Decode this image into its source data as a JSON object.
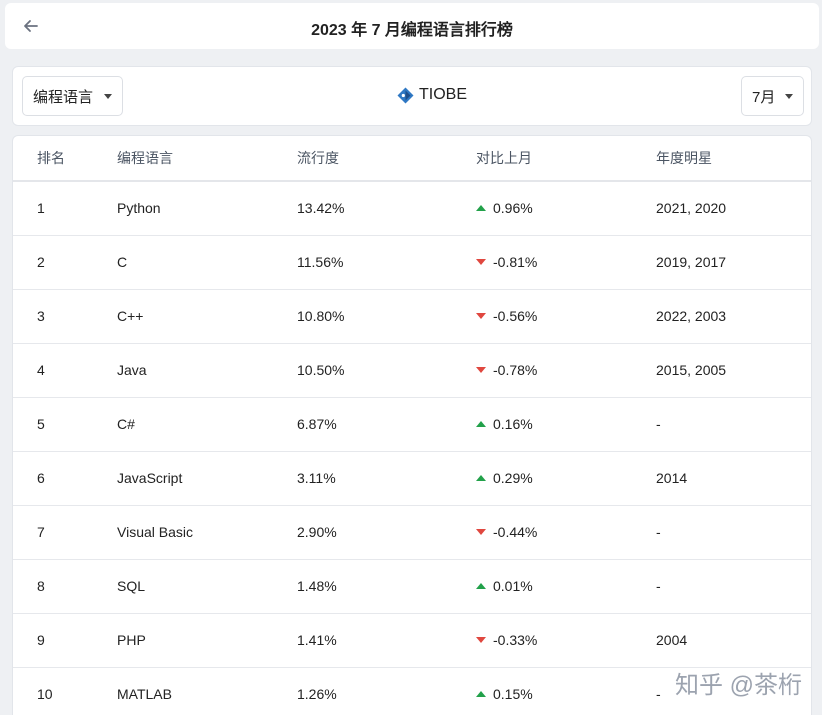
{
  "header": {
    "title": "2023 年 7 月编程语言排行榜"
  },
  "toolbar": {
    "language_select": "编程语言",
    "brand": "TIOBE",
    "month_select": "7月"
  },
  "table": {
    "columns": [
      "排名",
      "编程语言",
      "流行度",
      "对比上月",
      "年度明星"
    ],
    "rows": [
      {
        "rank": "1",
        "language": "Python",
        "popularity": "13.42%",
        "change": "0.96%",
        "direction": "up",
        "hof": "2021, 2020"
      },
      {
        "rank": "2",
        "language": "C",
        "popularity": "11.56%",
        "change": "-0.81%",
        "direction": "down",
        "hof": "2019, 2017"
      },
      {
        "rank": "3",
        "language": "C++",
        "popularity": "10.80%",
        "change": "-0.56%",
        "direction": "down",
        "hof": "2022, 2003"
      },
      {
        "rank": "4",
        "language": "Java",
        "popularity": "10.50%",
        "change": "-0.78%",
        "direction": "down",
        "hof": "2015, 2005"
      },
      {
        "rank": "5",
        "language": "C#",
        "popularity": "6.87%",
        "change": "0.16%",
        "direction": "up",
        "hof": "-"
      },
      {
        "rank": "6",
        "language": "JavaScript",
        "popularity": "3.11%",
        "change": "0.29%",
        "direction": "up",
        "hof": "2014"
      },
      {
        "rank": "7",
        "language": "Visual Basic",
        "popularity": "2.90%",
        "change": "-0.44%",
        "direction": "down",
        "hof": "-"
      },
      {
        "rank": "8",
        "language": "SQL",
        "popularity": "1.48%",
        "change": "0.01%",
        "direction": "up",
        "hof": "-"
      },
      {
        "rank": "9",
        "language": "PHP",
        "popularity": "1.41%",
        "change": "-0.33%",
        "direction": "down",
        "hof": "2004"
      },
      {
        "rank": "10",
        "language": "MATLAB",
        "popularity": "1.26%",
        "change": "0.15%",
        "direction": "up",
        "hof": "-"
      }
    ]
  },
  "watermark": "知乎 @茶桁",
  "colors": {
    "up": "#22a14a",
    "down": "#e0473f",
    "logo": "#2f78c4"
  },
  "icons": {
    "back": "arrow-left-icon",
    "dropdown": "caret-down-icon",
    "logo": "tiobe-logo-icon"
  }
}
